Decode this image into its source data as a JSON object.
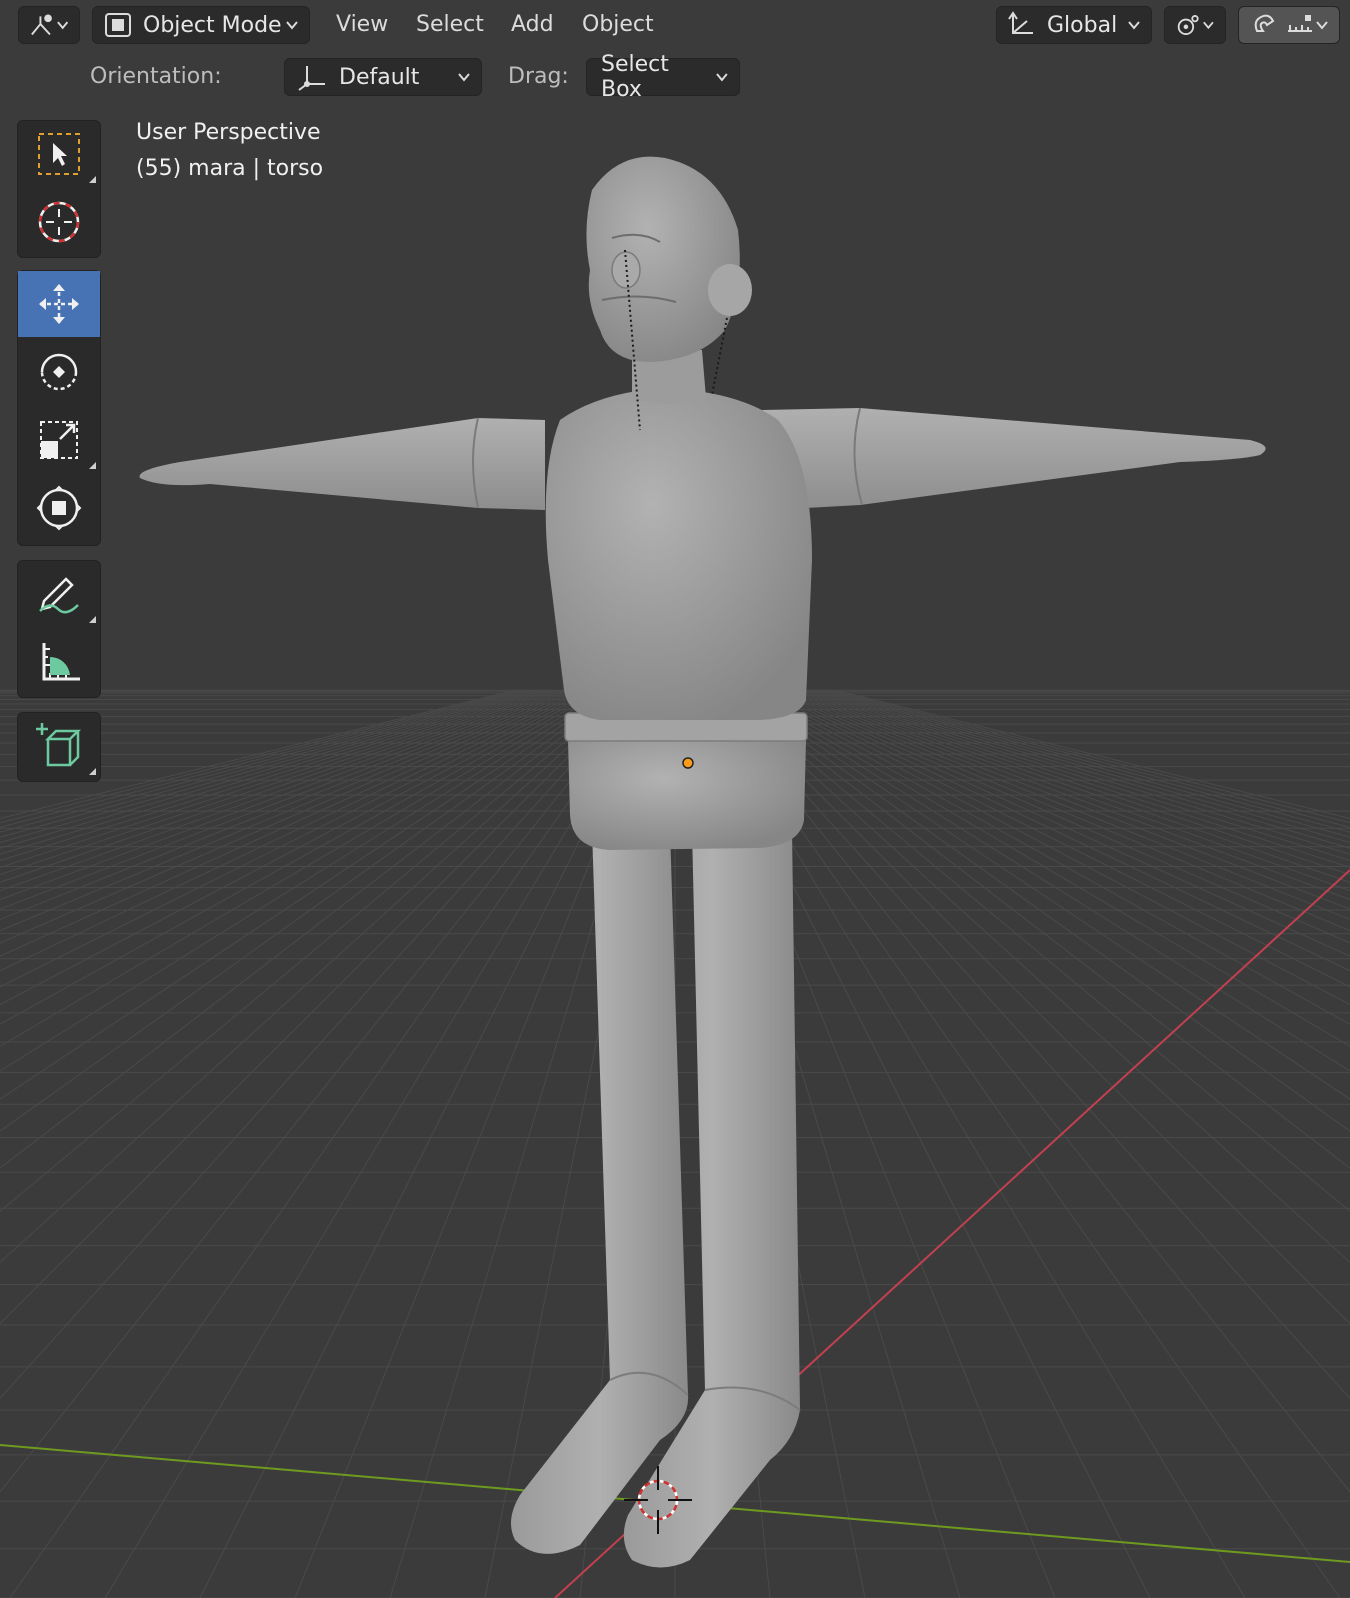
{
  "header": {
    "editor_type_icon": "viewport-editor-icon",
    "mode": "Object Mode",
    "menus": [
      "View",
      "Select",
      "Add",
      "Object"
    ],
    "transform_orientation": "Global",
    "pivot_icon": "pivot-point-icon",
    "snap_icon": "snap-magnet-icon",
    "snap_increment_icon": "snap-increment-icon"
  },
  "tool_settings": {
    "orientation_label": "Orientation:",
    "orientation_value": "Default",
    "drag_label": "Drag:",
    "drag_value": "Select Box"
  },
  "toolbar": {
    "tools": [
      "select-box-icon",
      "cursor-icon",
      "move-icon",
      "rotate-icon",
      "scale-icon",
      "transform-icon",
      "annotate-icon",
      "measure-icon",
      "add-cube-icon"
    ],
    "active_tool": "move-icon"
  },
  "viewport": {
    "view_name": "User Perspective",
    "object_info": "(55) mara | torso",
    "colors": {
      "background": "#3b3b3b",
      "grid": "#4a4a4a",
      "x_axis": "#c2404f",
      "y_axis": "#6e9a1f",
      "active_tool": "#4772b3",
      "origin_dot": "#ff9d1a"
    }
  }
}
